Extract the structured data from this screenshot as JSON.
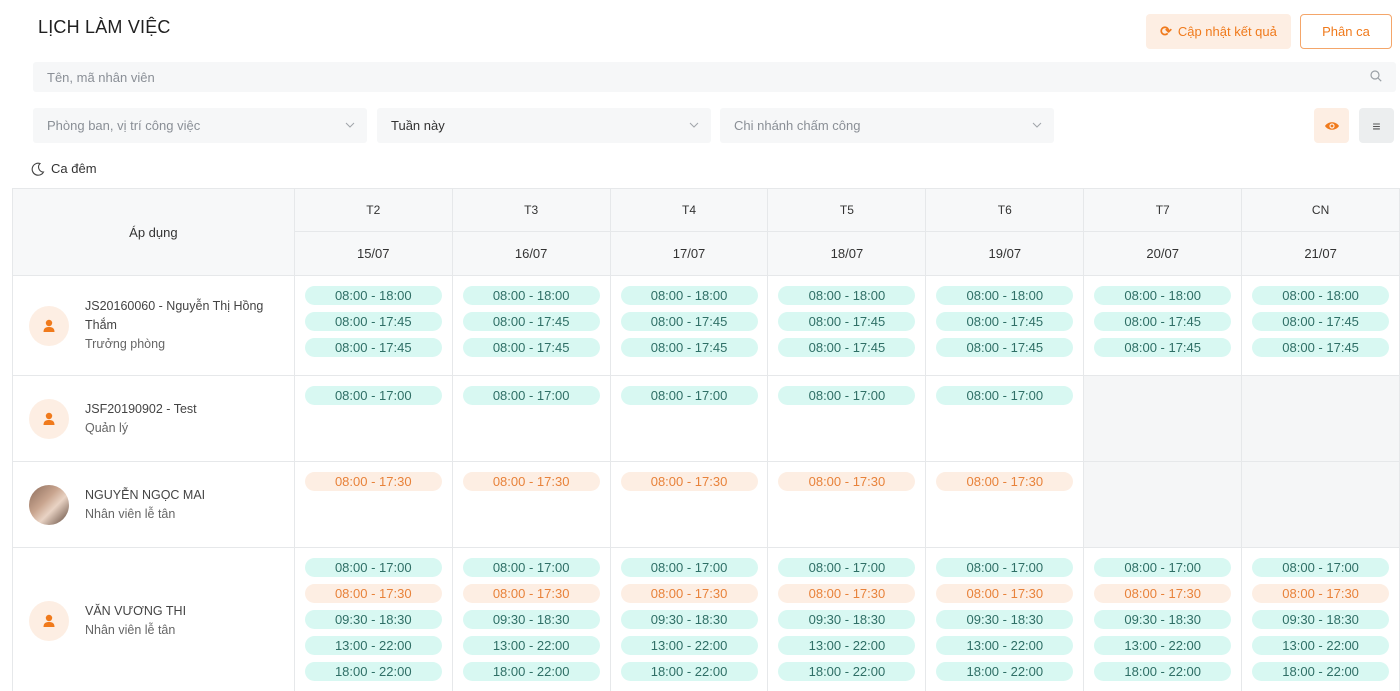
{
  "header": {
    "title": "LỊCH LÀM VIỆC",
    "update_label": "Cập nhật kết quả",
    "shift_label": "Phân ca"
  },
  "search": {
    "placeholder": "Tên, mã nhân viên"
  },
  "filters": {
    "department_placeholder": "Phòng ban, vị trí công việc",
    "week_value": "Tuần này",
    "branch_placeholder": "Chi nhánh chấm công"
  },
  "night_shift_label": "Ca đêm",
  "table": {
    "apply_header": "Áp dụng",
    "days": [
      {
        "dow": "T2",
        "date": "15/07"
      },
      {
        "dow": "T3",
        "date": "16/07"
      },
      {
        "dow": "T4",
        "date": "17/07"
      },
      {
        "dow": "T5",
        "date": "18/07"
      },
      {
        "dow": "T6",
        "date": "19/07"
      },
      {
        "dow": "T7",
        "date": "20/07"
      },
      {
        "dow": "CN",
        "date": "21/07"
      }
    ],
    "employees": [
      {
        "name": "JS20160060 - Nguyễn Thị Hồng Thắm",
        "role": "Trưởng phòng",
        "avatar": "person-icon",
        "days": [
          [
            {
              "time": "08:00 - 18:00",
              "color": "teal"
            },
            {
              "time": "08:00 - 17:45",
              "color": "teal"
            },
            {
              "time": "08:00 - 17:45",
              "color": "teal"
            }
          ],
          [
            {
              "time": "08:00 - 18:00",
              "color": "teal"
            },
            {
              "time": "08:00 - 17:45",
              "color": "teal"
            },
            {
              "time": "08:00 - 17:45",
              "color": "teal"
            }
          ],
          [
            {
              "time": "08:00 - 18:00",
              "color": "teal"
            },
            {
              "time": "08:00 - 17:45",
              "color": "teal"
            },
            {
              "time": "08:00 - 17:45",
              "color": "teal"
            }
          ],
          [
            {
              "time": "08:00 - 18:00",
              "color": "teal"
            },
            {
              "time": "08:00 - 17:45",
              "color": "teal"
            },
            {
              "time": "08:00 - 17:45",
              "color": "teal"
            }
          ],
          [
            {
              "time": "08:00 - 18:00",
              "color": "teal"
            },
            {
              "time": "08:00 - 17:45",
              "color": "teal"
            },
            {
              "time": "08:00 - 17:45",
              "color": "teal"
            }
          ],
          [
            {
              "time": "08:00 - 18:00",
              "color": "teal"
            },
            {
              "time": "08:00 - 17:45",
              "color": "teal"
            },
            {
              "time": "08:00 - 17:45",
              "color": "teal"
            }
          ],
          [
            {
              "time": "08:00 - 18:00",
              "color": "teal"
            },
            {
              "time": "08:00 - 17:45",
              "color": "teal"
            },
            {
              "time": "08:00 - 17:45",
              "color": "teal"
            }
          ]
        ]
      },
      {
        "name": "JSF20190902 - Test",
        "role": "Quản lý",
        "avatar": "person-icon",
        "days": [
          [
            {
              "time": "08:00 - 17:00",
              "color": "teal"
            }
          ],
          [
            {
              "time": "08:00 - 17:00",
              "color": "teal"
            }
          ],
          [
            {
              "time": "08:00 - 17:00",
              "color": "teal"
            }
          ],
          [
            {
              "time": "08:00 - 17:00",
              "color": "teal"
            }
          ],
          [
            {
              "time": "08:00 - 17:00",
              "color": "teal"
            }
          ],
          [],
          []
        ]
      },
      {
        "name": "NGUYỄN NGỌC MAI",
        "role": "Nhân viên lễ tân",
        "avatar": "photo",
        "days": [
          [
            {
              "time": "08:00 - 17:30",
              "color": "orange"
            }
          ],
          [
            {
              "time": "08:00 - 17:30",
              "color": "orange"
            }
          ],
          [
            {
              "time": "08:00 - 17:30",
              "color": "orange"
            }
          ],
          [
            {
              "time": "08:00 - 17:30",
              "color": "orange"
            }
          ],
          [
            {
              "time": "08:00 - 17:30",
              "color": "orange"
            }
          ],
          [],
          []
        ]
      },
      {
        "name": "VĂN VƯƠNG THI",
        "role": "Nhân viên lễ tân",
        "avatar": "person-icon",
        "days": [
          [
            {
              "time": "08:00 - 17:00",
              "color": "teal"
            },
            {
              "time": "08:00 - 17:30",
              "color": "orange"
            },
            {
              "time": "09:30 - 18:30",
              "color": "teal"
            },
            {
              "time": "13:00 - 22:00",
              "color": "teal"
            },
            {
              "time": "18:00 - 22:00",
              "color": "teal"
            }
          ],
          [
            {
              "time": "08:00 - 17:00",
              "color": "teal"
            },
            {
              "time": "08:00 - 17:30",
              "color": "orange"
            },
            {
              "time": "09:30 - 18:30",
              "color": "teal"
            },
            {
              "time": "13:00 - 22:00",
              "color": "teal"
            },
            {
              "time": "18:00 - 22:00",
              "color": "teal"
            }
          ],
          [
            {
              "time": "08:00 - 17:00",
              "color": "teal"
            },
            {
              "time": "08:00 - 17:30",
              "color": "orange"
            },
            {
              "time": "09:30 - 18:30",
              "color": "teal"
            },
            {
              "time": "13:00 - 22:00",
              "color": "teal"
            },
            {
              "time": "18:00 - 22:00",
              "color": "teal"
            }
          ],
          [
            {
              "time": "08:00 - 17:00",
              "color": "teal"
            },
            {
              "time": "08:00 - 17:30",
              "color": "orange"
            },
            {
              "time": "09:30 - 18:30",
              "color": "teal"
            },
            {
              "time": "13:00 - 22:00",
              "color": "teal"
            },
            {
              "time": "18:00 - 22:00",
              "color": "teal"
            }
          ],
          [
            {
              "time": "08:00 - 17:00",
              "color": "teal"
            },
            {
              "time": "08:00 - 17:30",
              "color": "orange"
            },
            {
              "time": "09:30 - 18:30",
              "color": "teal"
            },
            {
              "time": "13:00 - 22:00",
              "color": "teal"
            },
            {
              "time": "18:00 - 22:00",
              "color": "teal"
            }
          ],
          [
            {
              "time": "08:00 - 17:00",
              "color": "teal"
            },
            {
              "time": "08:00 - 17:30",
              "color": "orange"
            },
            {
              "time": "09:30 - 18:30",
              "color": "teal"
            },
            {
              "time": "13:00 - 22:00",
              "color": "teal"
            },
            {
              "time": "18:00 - 22:00",
              "color": "teal"
            }
          ],
          [
            {
              "time": "08:00 - 17:00",
              "color": "teal"
            },
            {
              "time": "08:00 - 17:30",
              "color": "orange"
            },
            {
              "time": "09:30 - 18:30",
              "color": "teal"
            },
            {
              "time": "13:00 - 22:00",
              "color": "teal"
            },
            {
              "time": "18:00 - 22:00",
              "color": "teal"
            }
          ]
        ]
      }
    ]
  },
  "colors": {
    "accent": "#f07a1c",
    "accent_bg": "#fdeee3",
    "shift_teal_bg": "#d8f8f2",
    "shift_teal_text": "#2f6f66",
    "shift_orange_bg": "#fdeee3",
    "shift_orange_text": "#e8823a"
  }
}
